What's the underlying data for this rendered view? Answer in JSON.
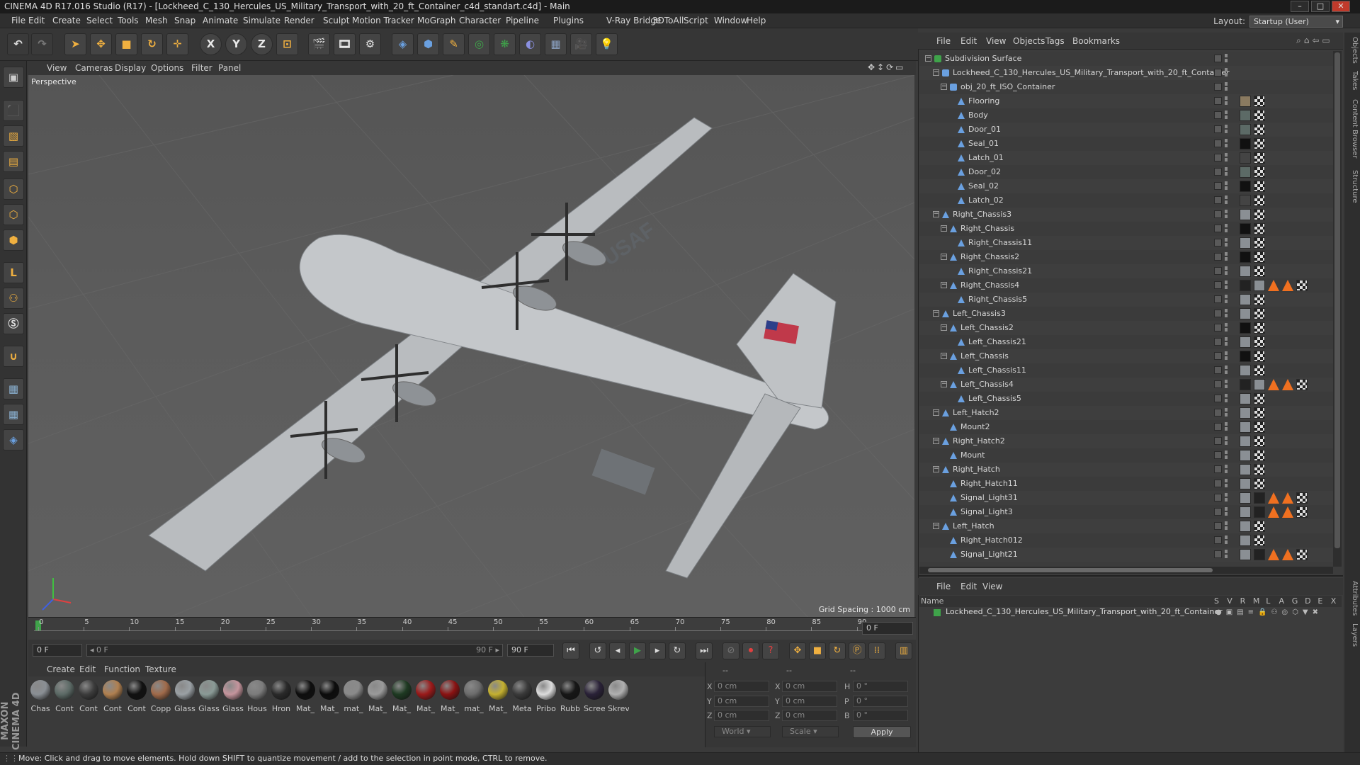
{
  "window": {
    "title": "CINEMA 4D R17.016 Studio (R17) - [Lockheed_C_130_Hercules_US_Military_Transport_with_20_ft_Container_c4d_standart.c4d] - Main",
    "minimize": "–",
    "maximize": "□",
    "close": "✕"
  },
  "menubar": [
    "File",
    "Edit",
    "Create",
    "Select",
    "Tools",
    "Mesh",
    "Snap",
    "Animate",
    "Simulate",
    "Render",
    "Sculpt",
    "Motion Tracker",
    "MoGraph",
    "Character",
    "Pipeline",
    "Plugins",
    "V-Ray Bridge",
    "3DToAll",
    "Script",
    "Window",
    "Help"
  ],
  "layout": {
    "label": "Layout:",
    "value": "Startup (User)"
  },
  "toolbar": {
    "undo": "↶",
    "redo": "↷",
    "x_axis": "X",
    "y_axis": "Y",
    "z_axis": "Z"
  },
  "viewport": {
    "menu": [
      "View",
      "Cameras",
      "Display",
      "Options",
      "Filter",
      "Panel"
    ],
    "camera_label": "Perspective",
    "grid_spacing": "Grid Spacing : 1000 cm",
    "wing_text": "USAF"
  },
  "timeline": {
    "ticks": [
      "0",
      "5",
      "10",
      "15",
      "20",
      "25",
      "30",
      "35",
      "40",
      "45",
      "50",
      "55",
      "60",
      "65",
      "70",
      "75",
      "80",
      "85",
      "90"
    ],
    "end_field": "0 F",
    "current_frame": "0 F",
    "range_start": "◂ 0 F",
    "range_end": "90 F ▸",
    "max_frame": "90 F"
  },
  "material_menu": [
    "Create",
    "Edit",
    "Function",
    "Texture"
  ],
  "materials": [
    {
      "label": "Chas",
      "color": "#8a8f94"
    },
    {
      "label": "Cont",
      "color": "#5c6a66"
    },
    {
      "label": "Cont",
      "color": "#3c3c3c"
    },
    {
      "label": "Cont",
      "color": "#b08050"
    },
    {
      "label": "Cont",
      "color": "#111111"
    },
    {
      "label": "Copp",
      "color": "#a06a4a"
    },
    {
      "label": "Glass",
      "color": "#9aa0a4"
    },
    {
      "label": "Glass",
      "color": "#8a9a96"
    },
    {
      "label": "Glass",
      "color": "#c4949c"
    },
    {
      "label": "Hous",
      "color": "#7c7c7c"
    },
    {
      "label": "Hron",
      "color": "#2a2a2a"
    },
    {
      "label": "Mat_",
      "color": "#0e0e0e"
    },
    {
      "label": "Mat_",
      "color": "#0c0c0c"
    },
    {
      "label": "mat_",
      "color": "#8a8a8a"
    },
    {
      "label": "Mat_",
      "color": "#9a9a9a"
    },
    {
      "label": "Mat_",
      "color": "#1e3a22"
    },
    {
      "label": "Mat_",
      "color": "#9a1a1a"
    },
    {
      "label": "Mat_",
      "color": "#8a1212"
    },
    {
      "label": "mat_",
      "color": "#6c6c6c"
    },
    {
      "label": "Mat_",
      "color": "#c4b030"
    },
    {
      "label": "Meta",
      "color": "#3a3a3a"
    },
    {
      "label": "Pribo",
      "color": "#dcdcdc"
    },
    {
      "label": "Rubb",
      "color": "#161616"
    },
    {
      "label": "Scree",
      "color": "#2a2238"
    },
    {
      "label": "Skrev",
      "color": "#b0b0b0"
    }
  ],
  "coords": {
    "header": [
      "--",
      "--",
      "--"
    ],
    "x": "X",
    "y": "Y",
    "z": "Z",
    "h": "H",
    "p": "P",
    "b": "B",
    "pos_x": "0 cm",
    "pos_y": "0 cm",
    "pos_z": "0 cm",
    "size_x": "0 cm",
    "size_y": "0 cm",
    "size_z": "0 cm",
    "rot_h": "0 °",
    "rot_p": "0 °",
    "rot_b": "0 °",
    "world": "World",
    "scale": "Scale",
    "apply": "Apply"
  },
  "object_manager": {
    "menu": [
      "File",
      "Edit",
      "View",
      "Objects",
      "Tags",
      "Bookmarks"
    ],
    "objects": [
      {
        "name": "Subdivision Surface",
        "indent": 0,
        "exp": "−",
        "icon": "#3fa34a",
        "tags": []
      },
      {
        "name": "Lockheed_C_130_Hercules_US_Military_Transport_with_20_ft_Container",
        "indent": 1,
        "exp": "−",
        "icon": "#6aa0e0",
        "tags": []
      },
      {
        "name": "obj_20_ft_ISO_Container",
        "indent": 2,
        "exp": "−",
        "icon": "#6aa0e0",
        "tags": []
      },
      {
        "name": "Flooring",
        "indent": 3,
        "exp": "",
        "icon": "tri",
        "tags": [
          "#8a7a60",
          "#ccc"
        ]
      },
      {
        "name": "Body",
        "indent": 3,
        "exp": "",
        "icon": "tri",
        "tags": [
          "#5c6a66",
          "#ccc"
        ]
      },
      {
        "name": "Door_01",
        "indent": 3,
        "exp": "",
        "icon": "tri",
        "tags": [
          "#5c6a66",
          "#ccc"
        ]
      },
      {
        "name": "Seal_01",
        "indent": 3,
        "exp": "",
        "icon": "tri",
        "tags": [
          "#111",
          "#ccc"
        ]
      },
      {
        "name": "Latch_01",
        "indent": 3,
        "exp": "",
        "icon": "tri",
        "tags": [
          "#444",
          "#ccc"
        ]
      },
      {
        "name": "Door_02",
        "indent": 3,
        "exp": "",
        "icon": "tri",
        "tags": [
          "#5c6a66",
          "#ccc"
        ]
      },
      {
        "name": "Seal_02",
        "indent": 3,
        "exp": "",
        "icon": "tri",
        "tags": [
          "#111",
          "#ccc"
        ]
      },
      {
        "name": "Latch_02",
        "indent": 3,
        "exp": "",
        "icon": "tri",
        "tags": [
          "#444",
          "#ccc"
        ]
      },
      {
        "name": "Right_Chassis3",
        "indent": 1,
        "exp": "−",
        "icon": "tri",
        "tags": [
          "#8a8f94",
          "#ccc"
        ]
      },
      {
        "name": "Right_Chassis",
        "indent": 2,
        "exp": "−",
        "icon": "tri",
        "tags": [
          "#111",
          "#ccc"
        ]
      },
      {
        "name": "Right_Chassis11",
        "indent": 3,
        "exp": "",
        "icon": "tri",
        "tags": [
          "#8a8f94",
          "#ccc"
        ]
      },
      {
        "name": "Right_Chassis2",
        "indent": 2,
        "exp": "−",
        "icon": "tri",
        "tags": [
          "#111",
          "#ccc"
        ]
      },
      {
        "name": "Right_Chassis21",
        "indent": 3,
        "exp": "",
        "icon": "tri",
        "tags": [
          "#8a8f94",
          "#ccc"
        ]
      },
      {
        "name": "Right_Chassis4",
        "indent": 2,
        "exp": "−",
        "icon": "tri",
        "tags": [
          "#222",
          "#8a8f94",
          "#f07020",
          "#f07020",
          "#ccc"
        ]
      },
      {
        "name": "Right_Chassis5",
        "indent": 3,
        "exp": "",
        "icon": "tri",
        "tags": [
          "#8a8f94",
          "#ccc"
        ]
      },
      {
        "name": "Left_Chassis3",
        "indent": 1,
        "exp": "−",
        "icon": "tri",
        "tags": [
          "#8a8f94",
          "#ccc"
        ]
      },
      {
        "name": "Left_Chassis2",
        "indent": 2,
        "exp": "−",
        "icon": "tri",
        "tags": [
          "#111",
          "#ccc"
        ]
      },
      {
        "name": "Left_Chassis21",
        "indent": 3,
        "exp": "",
        "icon": "tri",
        "tags": [
          "#8a8f94",
          "#ccc"
        ]
      },
      {
        "name": "Left_Chassis",
        "indent": 2,
        "exp": "−",
        "icon": "tri",
        "tags": [
          "#111",
          "#ccc"
        ]
      },
      {
        "name": "Left_Chassis11",
        "indent": 3,
        "exp": "",
        "icon": "tri",
        "tags": [
          "#8a8f94",
          "#ccc"
        ]
      },
      {
        "name": "Left_Chassis4",
        "indent": 2,
        "exp": "−",
        "icon": "tri",
        "tags": [
          "#222",
          "#8a8f94",
          "#f07020",
          "#f07020",
          "#ccc"
        ]
      },
      {
        "name": "Left_Chassis5",
        "indent": 3,
        "exp": "",
        "icon": "tri",
        "tags": [
          "#8a8f94",
          "#ccc"
        ]
      },
      {
        "name": "Left_Hatch2",
        "indent": 1,
        "exp": "−",
        "icon": "tri",
        "tags": [
          "#8a8f94",
          "#ccc"
        ]
      },
      {
        "name": "Mount2",
        "indent": 2,
        "exp": "",
        "icon": "tri",
        "tags": [
          "#8a8f94",
          "#ccc"
        ]
      },
      {
        "name": "Right_Hatch2",
        "indent": 1,
        "exp": "−",
        "icon": "tri",
        "tags": [
          "#8a8f94",
          "#ccc"
        ]
      },
      {
        "name": "Mount",
        "indent": 2,
        "exp": "",
        "icon": "tri",
        "tags": [
          "#8a8f94",
          "#ccc"
        ]
      },
      {
        "name": "Right_Hatch",
        "indent": 1,
        "exp": "−",
        "icon": "tri",
        "tags": [
          "#8a8f94",
          "#ccc"
        ]
      },
      {
        "name": "Right_Hatch11",
        "indent": 2,
        "exp": "",
        "icon": "tri",
        "tags": [
          "#8a8f94",
          "#ccc"
        ]
      },
      {
        "name": "Signal_Light31",
        "indent": 2,
        "exp": "",
        "icon": "tri",
        "tags": [
          "#8a8f94",
          "#222",
          "#f07020",
          "#f07020",
          "#ccc"
        ]
      },
      {
        "name": "Signal_Light3",
        "indent": 2,
        "exp": "",
        "icon": "tri",
        "tags": [
          "#8a8f94",
          "#222",
          "#f07020",
          "#f07020",
          "#ccc"
        ]
      },
      {
        "name": "Left_Hatch",
        "indent": 1,
        "exp": "−",
        "icon": "tri",
        "tags": [
          "#8a8f94",
          "#ccc"
        ]
      },
      {
        "name": "Right_Hatch012",
        "indent": 2,
        "exp": "",
        "icon": "tri",
        "tags": [
          "#8a8f94",
          "#ccc"
        ]
      },
      {
        "name": "Signal_Light21",
        "indent": 2,
        "exp": "",
        "icon": "tri",
        "tags": [
          "#8a8f94",
          "#222",
          "#f07020",
          "#f07020",
          "#ccc"
        ]
      }
    ]
  },
  "attribute_manager": {
    "menu": [
      "File",
      "Edit",
      "View"
    ],
    "header_name": "Name",
    "header_cols": [
      "S",
      "V",
      "R",
      "M",
      "L",
      "A",
      "G",
      "D",
      "E",
      "X"
    ],
    "selected": "Lockheed_C_130_Hercules_US_Military_Transport_with_20_ft_Container"
  },
  "right_tabs": [
    "Objects",
    "Takes",
    "Content Browser",
    "Structure",
    "Attributes",
    "Layers"
  ],
  "status": "Move: Click and drag to move elements. Hold down SHIFT to quantize movement / add to the selection in point mode, CTRL to remove.",
  "maxon": "MAXON CINEMA 4D",
  "colors": {
    "accent": "#f0b040",
    "selection": "#3fa34a",
    "axis_x": "#e04040",
    "axis_y": "#40c040",
    "axis_z": "#4060e0"
  }
}
